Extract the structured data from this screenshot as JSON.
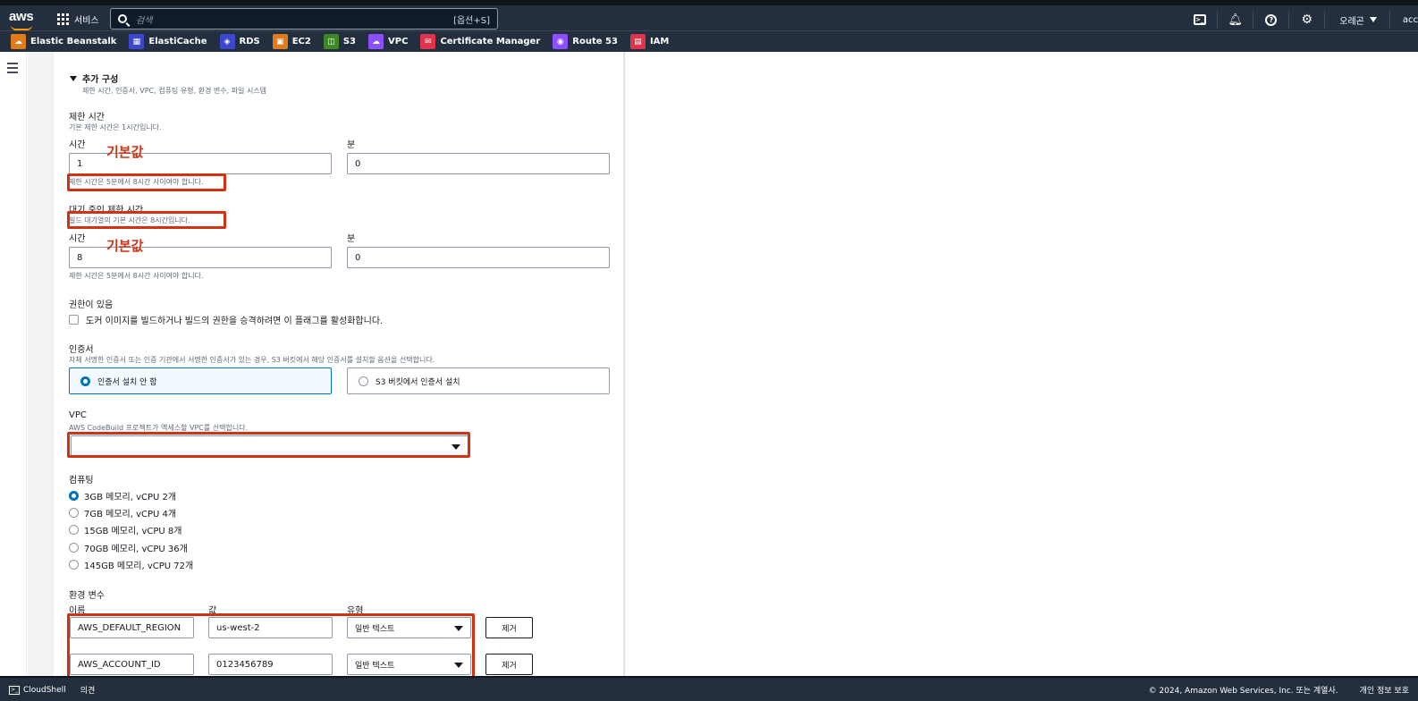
{
  "topnav": {
    "logo": "aws",
    "services_label": "서비스",
    "search_placeholder": "검색",
    "search_shortcut": "[옵션+S]",
    "region": "오레곤",
    "account": "acc"
  },
  "favorites": [
    {
      "label": "Elastic Beanstalk",
      "color": "#e07b1a",
      "icon": "beanstalk-icon"
    },
    {
      "label": "ElastiCache",
      "color": "#3b48cc",
      "icon": "elasticache-icon"
    },
    {
      "label": "RDS",
      "color": "#3b48cc",
      "icon": "rds-icon"
    },
    {
      "label": "EC2",
      "color": "#e07b1a",
      "icon": "ec2-icon"
    },
    {
      "label": "S3",
      "color": "#3f8624",
      "icon": "s3-icon"
    },
    {
      "label": "VPC",
      "color": "#8c4fff",
      "icon": "vpc-icon"
    },
    {
      "label": "Certificate Manager",
      "color": "#dd344c",
      "icon": "certificate-icon"
    },
    {
      "label": "Route 53",
      "color": "#8c4fff",
      "icon": "route53-icon"
    },
    {
      "label": "IAM",
      "color": "#dd344c",
      "icon": "iam-icon"
    }
  ],
  "form": {
    "additional_config": {
      "title": "추가 구성",
      "subtitle": "제한 시간, 인증서, VPC, 컴퓨팅 유형, 환경 변수, 파일 시스템"
    },
    "timeout": {
      "title": "제한 시간",
      "desc": "기본 제한 시간은 1시간입니다.",
      "hours_label": "시간",
      "minutes_label": "분",
      "hours_value": "1",
      "minutes_value": "0",
      "hint": "제한 시간은 5분에서 8시간 사이여야 합니다."
    },
    "queued_timeout": {
      "title": "대기 중인 제한 시간",
      "desc": "빌드 대기열의 기본 시간은 8시간입니다.",
      "hours_label": "시간",
      "minutes_label": "분",
      "hours_value": "8",
      "minutes_value": "0",
      "hint": "제한 시간은 5분에서 8시간 사이여야 합니다."
    },
    "privileged": {
      "title": "권한이 있음",
      "checkbox_label": "도커 이미지를 빌드하거나 빌드의 권한을 승격하려면 이 플래그를 활성화합니다."
    },
    "certificate": {
      "title": "인증서",
      "desc": "자체 서명한 인증서 또는 인증 기관에서 서명한 인증서가 있는 경우, S3 버킷에서 해당 인증서를 설치할 옵션을 선택합니다.",
      "option_none": "인증서 설치 안 함",
      "option_s3": "S3 버킷에서 인증서 설치"
    },
    "vpc": {
      "title": "VPC",
      "desc": "AWS CodeBuild 프로젝트가 액세스할 VPC를 선택합니다.",
      "value": ""
    },
    "compute": {
      "title": "컴퓨팅",
      "options": [
        "3GB 메모리, vCPU 2개",
        "7GB 메모리, vCPU 4개",
        "15GB 메모리, vCPU 8개",
        "70GB 메모리, vCPU 36개",
        "145GB 메모리, vCPU 72개"
      ],
      "selected_index": 0
    },
    "env": {
      "title": "환경 변수",
      "col_name": "이름",
      "col_value": "값",
      "col_type": "유형",
      "remove_label": "제거",
      "rows": [
        {
          "name": "AWS_DEFAULT_REGION",
          "value": "us-west-2",
          "type": "일반 텍스트"
        },
        {
          "name": "AWS_ACCOUNT_ID",
          "value": "0123456789",
          "type": "일반 텍스트"
        }
      ]
    }
  },
  "annotations": {
    "default_label_1": "기본값",
    "default_label_2": "기본값"
  },
  "footer": {
    "cloudshell": "CloudShell",
    "feedback": "의견",
    "copyright": "© 2024, Amazon Web Services, Inc. 또는 계열사.",
    "privacy": "개인 정보 보호"
  },
  "colors": {
    "nav_bg": "#232f3e",
    "accent_blue": "#0073bb",
    "annotation_red": "#d13212"
  }
}
